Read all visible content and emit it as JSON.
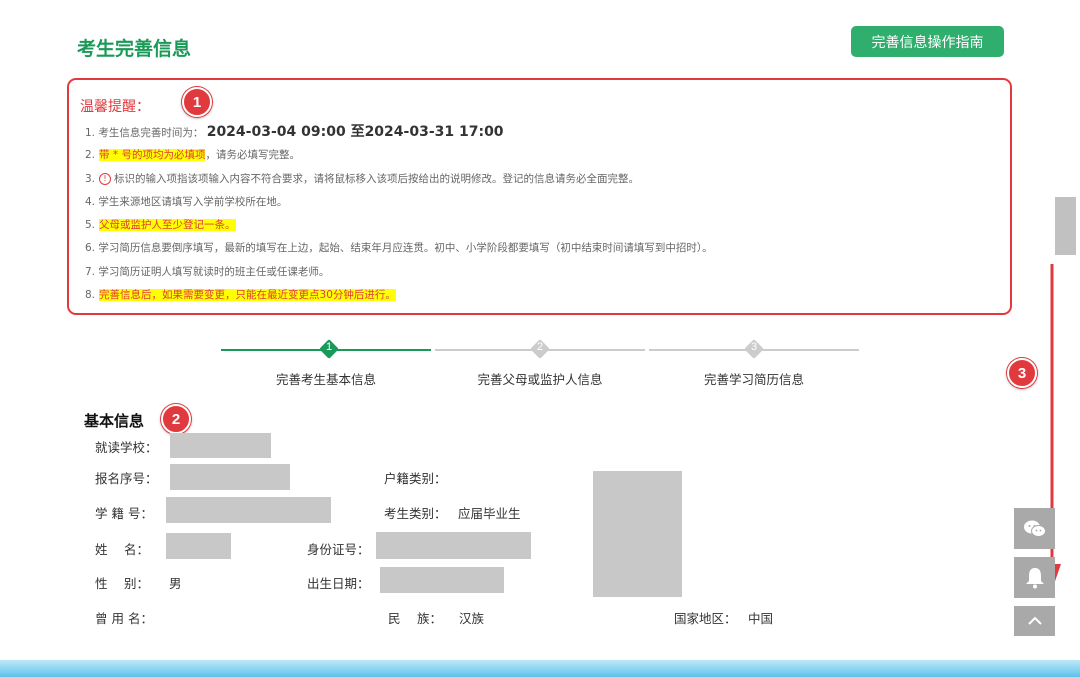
{
  "page": {
    "title": "考生完善信息",
    "guide_button": "完善信息操作指南"
  },
  "notice": {
    "title": "温馨提醒：",
    "items": {
      "i1_prefix": "1. 考生信息完善时间为：",
      "i1_time": "2024-03-04 09:00 至2024-03-31 17:00",
      "i2_num": "2.",
      "i2_highlight": "带 * 号的项均为必填项",
      "i2_rest": "，请务必填写完整。",
      "i3_num": "3.",
      "i3_icon": "!",
      "i3_text": "标识的输入项指该项输入内容不符合要求，请将鼠标移入该项后按给出的说明修改。登记的信息请务必全面完整。",
      "i4": "4. 学生来源地区请填写入学前学校所在地。",
      "i5_num": "5.",
      "i5_highlight": "父母或监护人至少登记一条。",
      "i6": "6. 学习简历信息要倒序填写，最新的填写在上边，起始、结束年月应连贯。初中、小学阶段都要填写（初中结束时间请填写到中招时）。",
      "i7": "7. 学习简历证明人填写就读时的班主任或任课老师。",
      "i8_num": "8.",
      "i8_highlight": "完善信息后，如果需要变更，只能在最近变更点30分钟后进行。"
    }
  },
  "badges": {
    "b1": "1",
    "b2": "2",
    "b3": "3"
  },
  "steps": [
    {
      "num": "1",
      "label": "完善考生基本信息"
    },
    {
      "num": "2",
      "label": "完善父母或监护人信息"
    },
    {
      "num": "3",
      "label": "完善学习简历信息"
    }
  ],
  "basic_info": {
    "title": "基本信息",
    "school_label": "就读学校：",
    "reg_no_label": "报名序号：",
    "student_no_label": "学 籍 号：",
    "name_label": "姓　 名：",
    "gender_label": "性　 别：",
    "gender_value": "男",
    "former_name_label": "曾 用 名：",
    "hukou_label": "户籍类别：",
    "exam_type_label": "考生类别：",
    "exam_type_value": "应届毕业生",
    "id_label": "身份证号：",
    "birth_label": "出生日期：",
    "ethnicity_label": "民　 族：",
    "ethnicity_value": "汉族",
    "country_label": "国家地区：",
    "country_value": "中国"
  },
  "colors": {
    "accent_green": "#1a9a58",
    "alert_red": "#e03a3e",
    "highlight_yellow": "#ffff00"
  },
  "icons": [
    "wechat-icon",
    "bell-icon",
    "chevron-up-icon",
    "scroll-down-arrow-icon"
  ]
}
